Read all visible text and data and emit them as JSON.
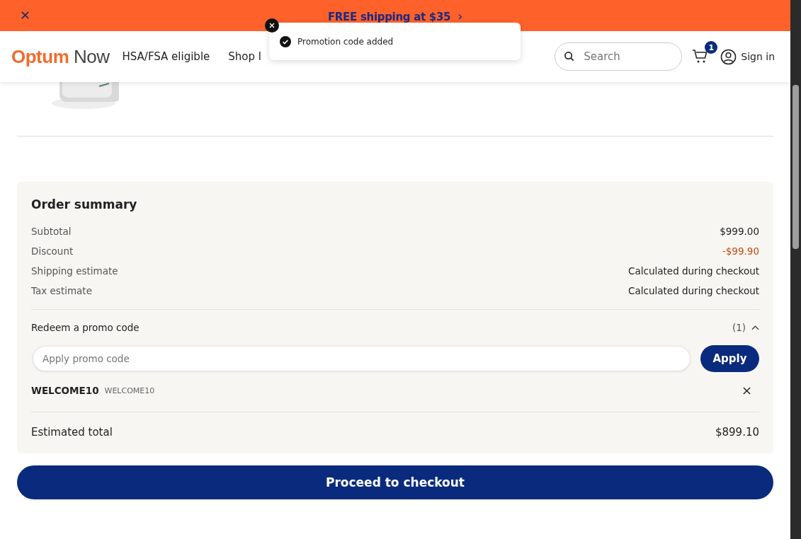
{
  "banner": {
    "text": "FREE shipping at $35",
    "chevron": "›"
  },
  "header": {
    "logo_brand": "Optum",
    "logo_product": "Now",
    "nav": [
      "HSA/FSA eligible",
      "Shop l"
    ],
    "search": {
      "placeholder": "Search"
    },
    "cart_count": "1",
    "sign_in": "Sign in"
  },
  "toast": {
    "message": "Promotion code added"
  },
  "order_summary": {
    "title": "Order summary",
    "lines": [
      {
        "label": "Subtotal",
        "value": "$999.00",
        "kind": "normal"
      },
      {
        "label": "Discount",
        "value": "-$99.90",
        "kind": "discount"
      },
      {
        "label": "Shipping estimate",
        "value": "Calculated during checkout",
        "kind": "normal"
      },
      {
        "label": "Tax estimate",
        "value": "Calculated during checkout",
        "kind": "normal"
      }
    ],
    "promo": {
      "title": "Redeem a promo code",
      "count": "(1)",
      "expanded": true,
      "placeholder": "Apply promo code",
      "apply": "Apply",
      "codes": [
        {
          "code": "WELCOME10",
          "description": "WELCOME10"
        }
      ]
    },
    "total_label": "Estimated total",
    "total_value": "$899.10"
  },
  "checkout": "Proceed to checkout"
}
